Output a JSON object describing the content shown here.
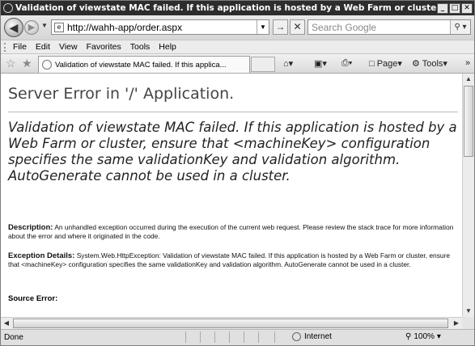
{
  "window": {
    "title": "Validation of viewstate MAC failed. If this application is hosted by a Web Farm or cluster, ens - Wind...",
    "minimize": "_",
    "maximize": "□",
    "close": "✕"
  },
  "address": {
    "url": "http://wahh-app/order.aspx"
  },
  "search": {
    "placeholder": "Search Google"
  },
  "menu": {
    "file": "File",
    "edit": "Edit",
    "view": "View",
    "favorites": "Favorites",
    "tools": "Tools",
    "help": "Help"
  },
  "tab": {
    "title": "Validation of viewstate MAC failed. If this applica..."
  },
  "commands": {
    "page": "Page",
    "tools": "Tools",
    "more": "»"
  },
  "page": {
    "heading": "Server Error in '/' Application.",
    "error_title": "Validation of viewstate MAC failed. If this application is hosted by a Web Farm or cluster, ensure that <machineKey> configuration specifies the same validationKey and validation algorithm. AutoGenerate cannot be used in a cluster.",
    "description_label": "Description:",
    "description_text": "An unhandled exception occurred during the execution of the current web request. Please review the stack trace for more information about the error and where it originated in the code.",
    "exception_label": "Exception Details:",
    "exception_text": "System.Web.HttpException: Validation of viewstate MAC failed. If this application is hosted by a Web Farm or cluster, ensure that <machineKey> configuration specifies the same validationKey and validation algorithm. AutoGenerate cannot be used in a cluster.",
    "source_error_label": "Source Error:"
  },
  "status": {
    "text": "Done",
    "zone": "Internet",
    "zoom": "100%"
  }
}
